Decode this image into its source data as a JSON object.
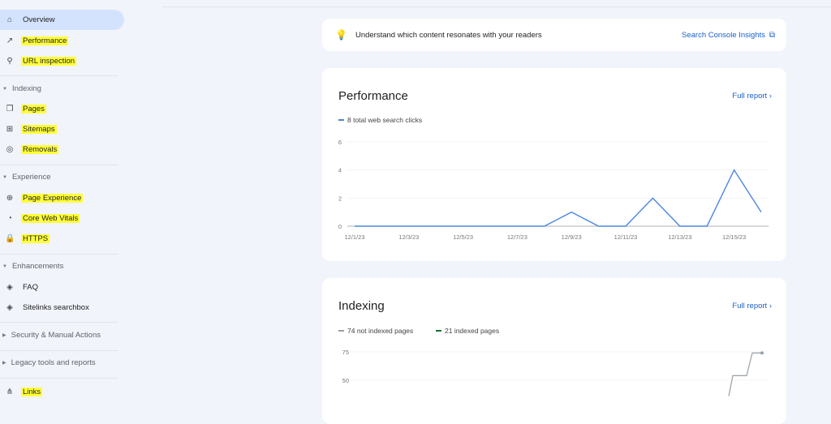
{
  "sidebar": {
    "items": [
      {
        "label": "Overview",
        "icon": "home-icon",
        "active": true,
        "highlighted": false
      },
      {
        "label": "Performance",
        "icon": "trending-up-icon",
        "highlighted": true
      },
      {
        "label": "URL inspection",
        "icon": "search-icon",
        "highlighted": true
      }
    ],
    "sections": [
      {
        "title": "Indexing",
        "items": [
          {
            "label": "Pages",
            "icon": "pages-icon",
            "highlighted": true
          },
          {
            "label": "Sitemaps",
            "icon": "sitemap-icon",
            "highlighted": true
          },
          {
            "label": "Removals",
            "icon": "eye-off-icon",
            "highlighted": true
          }
        ]
      },
      {
        "title": "Experience",
        "items": [
          {
            "label": "Page Experience",
            "icon": "plus-circle-icon",
            "highlighted": true
          },
          {
            "label": "Core Web Vitals",
            "icon": "gauge-icon",
            "highlighted": true
          },
          {
            "label": "HTTPS",
            "icon": "lock-icon",
            "highlighted": true
          }
        ]
      },
      {
        "title": "Enhancements",
        "items": [
          {
            "label": "FAQ",
            "icon": "layers-icon",
            "highlighted": false
          },
          {
            "label": "Sitelinks searchbox",
            "icon": "layers-icon",
            "highlighted": false
          }
        ]
      },
      {
        "title": "Security & Manual Actions",
        "items": []
      },
      {
        "title": "Legacy tools and reports",
        "items": []
      }
    ],
    "bottom": {
      "label": "Links",
      "icon": "links-icon",
      "highlighted": true
    }
  },
  "insight": {
    "text": "Understand which content resonates with your readers",
    "link": "Search Console Insights"
  },
  "performance": {
    "title": "Performance",
    "full_report": "Full report"
  },
  "indexing": {
    "title": "Indexing",
    "full_report": "Full report"
  },
  "colors": {
    "clicks": "#4a86e0",
    "not_indexed": "#9aa0a6",
    "indexed": "#137333",
    "highlight": "#ffff3a"
  },
  "chart_data": [
    {
      "type": "line",
      "legend": [
        "8 total web search clicks"
      ],
      "x": [
        "12/1/23",
        "12/2/23",
        "12/3/23",
        "12/4/23",
        "12/5/23",
        "12/6/23",
        "12/7/23",
        "12/8/23",
        "12/9/23",
        "12/10/23",
        "12/11/23",
        "12/12/23",
        "12/13/23",
        "12/14/23",
        "12/15/23",
        "12/16/23"
      ],
      "xticks": [
        "12/1/23",
        "12/3/23",
        "12/5/23",
        "12/7/23",
        "12/9/23",
        "12/11/23",
        "12/13/23",
        "12/15/23"
      ],
      "series": [
        {
          "name": "8 total web search clicks",
          "values": [
            0,
            0,
            0,
            0,
            0,
            0,
            0,
            0,
            1,
            0,
            0,
            2,
            0,
            0,
            4,
            1
          ]
        }
      ],
      "yticks": [
        0,
        2,
        4,
        6
      ],
      "ylim": [
        0,
        6
      ],
      "grid": true,
      "legend_position": "top-left"
    },
    {
      "type": "line",
      "legend": [
        "74 not indexed pages",
        "21 indexed pages"
      ],
      "yticks": [
        50,
        75
      ],
      "ylim": [
        25,
        75
      ],
      "grid": true,
      "legend_position": "top-left",
      "series": [
        {
          "name": "74 not indexed pages",
          "values": [
            36,
            54,
            54,
            74,
            74
          ]
        }
      ]
    }
  ]
}
